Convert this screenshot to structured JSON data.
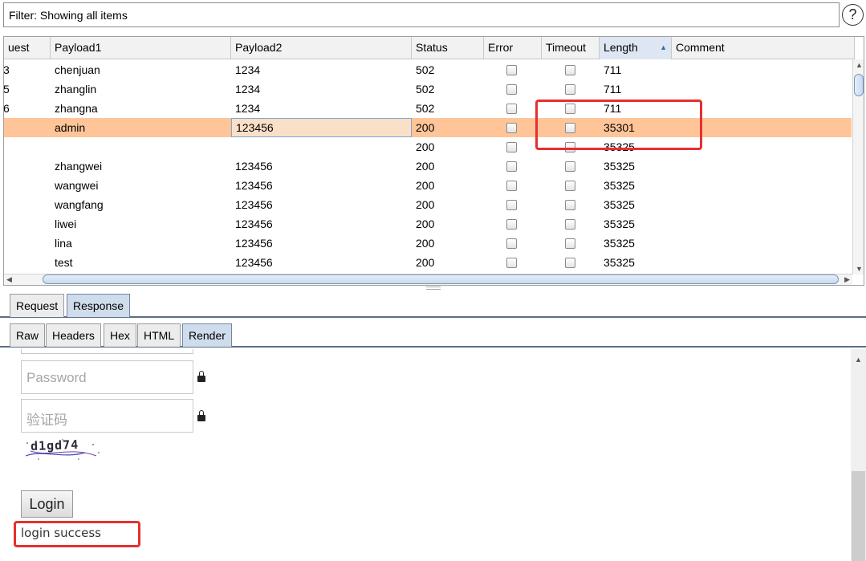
{
  "filter": {
    "label": "Filter: Showing all items"
  },
  "help_icon": {
    "glyph": "?"
  },
  "table": {
    "columns": [
      "uest",
      "Payload1",
      "Payload2",
      "Status",
      "Error",
      "Timeout",
      "Length",
      "Comment"
    ],
    "sort_indicator": "▲",
    "rows": [
      {
        "request": "3",
        "payload1": "chenjuan",
        "payload2": "1234",
        "status": "502",
        "length": "711"
      },
      {
        "request": "5",
        "payload1": "zhanglin",
        "payload2": "1234",
        "status": "502",
        "length": "711"
      },
      {
        "request": "6",
        "payload1": "zhangna",
        "payload2": "1234",
        "status": "502",
        "length": "711"
      },
      {
        "request": "",
        "payload1": "admin",
        "payload2": "123456",
        "status": "200",
        "length": "35301",
        "selected": true
      },
      {
        "request": "",
        "payload1": "",
        "payload2": "",
        "status": "200",
        "length": "35325"
      },
      {
        "request": "",
        "payload1": "zhangwei",
        "payload2": "123456",
        "status": "200",
        "length": "35325"
      },
      {
        "request": "",
        "payload1": "wangwei",
        "payload2": "123456",
        "status": "200",
        "length": "35325"
      },
      {
        "request": "",
        "payload1": "wangfang",
        "payload2": "123456",
        "status": "200",
        "length": "35325"
      },
      {
        "request": "",
        "payload1": "liwei",
        "payload2": "123456",
        "status": "200",
        "length": "35325"
      },
      {
        "request": "",
        "payload1": "lina",
        "payload2": "123456",
        "status": "200",
        "length": "35325"
      },
      {
        "request": "",
        "payload1": "test",
        "payload2": "123456",
        "status": "200",
        "length": "35325"
      }
    ]
  },
  "tabs_top": [
    "Request",
    "Response"
  ],
  "tabs_sub": [
    "Raw",
    "Headers",
    "Hex",
    "HTML",
    "Render"
  ],
  "render": {
    "password_placeholder": "Password",
    "captcha_placeholder": "验证码",
    "captcha_text": "d1gd74",
    "login_button": "Login",
    "message": "login success"
  },
  "colors": {
    "selected_row": "#ffc599",
    "highlight": "#e53030",
    "active_tab": "#cfdceb"
  }
}
